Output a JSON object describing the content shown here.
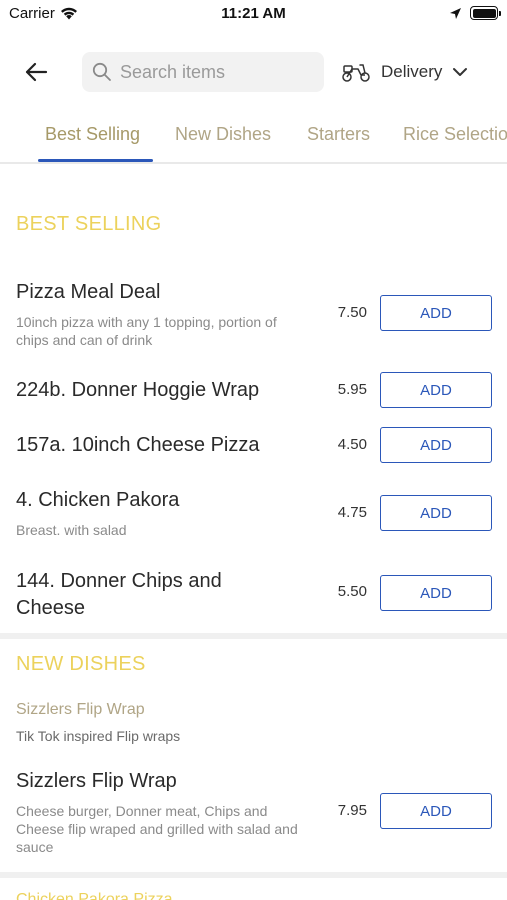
{
  "status_bar": {
    "carrier": "Carrier",
    "time": "11:21 AM"
  },
  "header": {
    "search_placeholder": "Search items",
    "delivery_label": "Delivery"
  },
  "tabs": [
    {
      "label": "Best Selling",
      "active": true
    },
    {
      "label": "New Dishes"
    },
    {
      "label": "Starters"
    },
    {
      "label": "Rice Selection"
    }
  ],
  "sections": {
    "best_selling": {
      "title": "BEST SELLING",
      "items": [
        {
          "name": "Pizza Meal Deal",
          "desc": "10inch pizza with any 1 topping, portion of chips and can of drink",
          "price": "7.50",
          "add": "ADD"
        },
        {
          "name": "224b. Donner Hoggie Wrap",
          "desc": "",
          "price": "5.95",
          "add": "ADD"
        },
        {
          "name": "157a. 10inch Cheese Pizza",
          "desc": "",
          "price": "4.50",
          "add": "ADD"
        },
        {
          "name": "4. Chicken Pakora",
          "desc": "Breast. with salad",
          "price": "4.75",
          "add": "ADD"
        },
        {
          "name": "144. Donner Chips and Cheese",
          "desc": "",
          "price": "5.50",
          "add": "ADD"
        }
      ]
    },
    "new_dishes": {
      "title": "NEW DISHES",
      "subcategory": {
        "title": "Sizzlers Flip Wrap",
        "desc": "Tik Tok inspired Flip wraps"
      },
      "items": [
        {
          "name": "Sizzlers Flip Wrap",
          "desc": "Cheese burger, Donner meat, Chips and Cheese flip wraped and grilled with salad and sauce",
          "price": "7.95",
          "add": "ADD"
        }
      ]
    },
    "next_peek": "Chicken Pakora Pizza"
  },
  "colors": {
    "accent": "#2b57b9",
    "section_title": "#ecd25c",
    "tab_text": "#b0a586"
  }
}
